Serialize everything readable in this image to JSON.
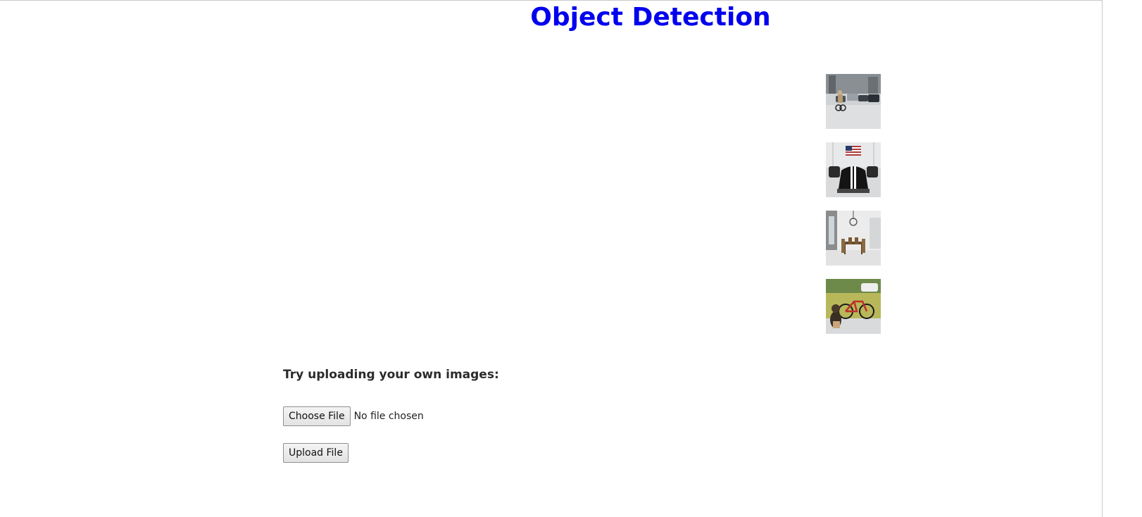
{
  "page": {
    "title": "Object Detection",
    "title_color": "#0000ee"
  },
  "thumbnails": [
    {
      "name": "street-scene-thumbnail",
      "subject": "street with cyclist and cars"
    },
    {
      "name": "garage-car-thumbnail",
      "subject": "black car in garage with flag"
    },
    {
      "name": "dining-room-thumbnail",
      "subject": "dining room with chandelier"
    },
    {
      "name": "dog-bicycle-thumbnail",
      "subject": "dog beside bicycle"
    }
  ],
  "upload": {
    "heading": "Try uploading your own images:",
    "choose_label": "Choose File",
    "file_status": "No file chosen",
    "upload_label": "Upload File"
  }
}
